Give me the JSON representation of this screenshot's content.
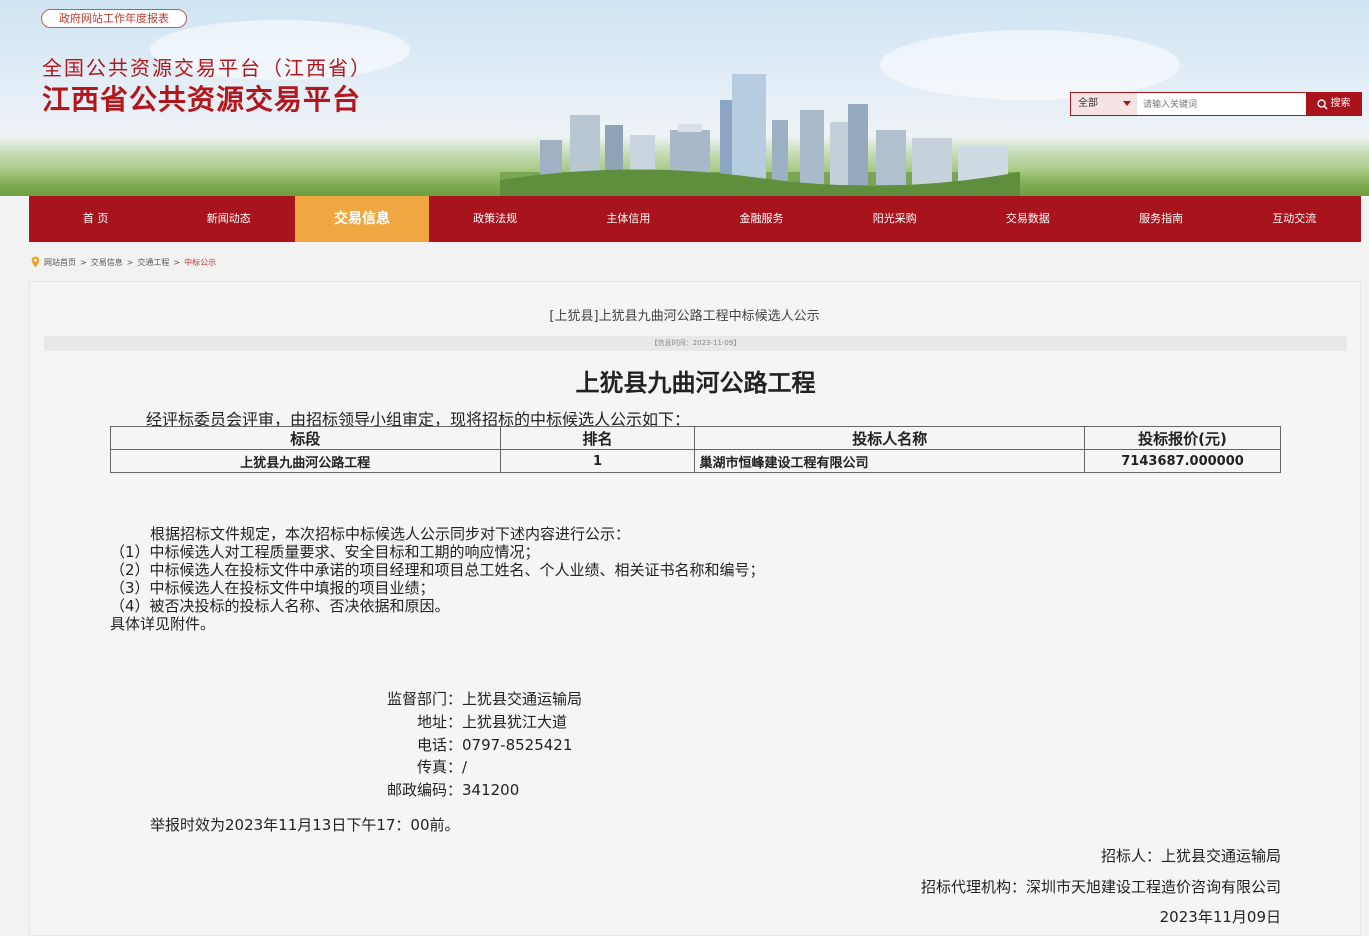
{
  "header": {
    "report_link": "政府网站工作年度报表",
    "title_line1": "全国公共资源交易平台（江西省）",
    "title_line2": "江西省公共资源交易平台",
    "search": {
      "scope": "全部",
      "placeholder": "请输入关键词",
      "button": "搜索"
    }
  },
  "nav": {
    "items": [
      "首 页",
      "新闻动态",
      "交易信息",
      "政策法规",
      "主体信用",
      "金融服务",
      "阳光采购",
      "交易数据",
      "服务指南",
      "互动交流"
    ],
    "active": "交易信息"
  },
  "breadcrumb": {
    "items": [
      "网站首页",
      "交易信息",
      "交通工程"
    ],
    "current": "中标公示"
  },
  "article": {
    "title": "[上犹县]上犹县九曲河公路工程中标候选人公示",
    "info_time": "【信息时间：2023-11-09】",
    "heading": "上犹县九曲河公路工程",
    "intro": "经评标委员会评审，由招标领导小组审定，现将招标的中标候选人公示如下：",
    "table": {
      "headers": [
        "标段",
        "排名",
        "投标人名称",
        "投标报价(元)"
      ],
      "rows": [
        [
          "上犹县九曲河公路工程",
          "1",
          "巢湖市恒峰建设工程有限公司",
          "7143687.000000"
        ]
      ]
    },
    "body": [
      "根据招标文件规定，本次招标中标候选人公示同步对下述内容进行公示：",
      "（1）中标候选人对工程质量要求、安全目标和工期的响应情况；",
      "（2）中标候选人在投标文件中承诺的项目经理和项目总工姓名、个人业绩、相关证书名称和编号；",
      "（3）中标候选人在投标文件中填报的项目业绩；",
      "（4）被否决投标的投标人名称、否决依据和原因。",
      "具体详见附件。"
    ],
    "contacts": [
      {
        "label": "监督部门：",
        "value": "上犹县交通运输局"
      },
      {
        "label": "地址：",
        "value": "上犹县犹江大道"
      },
      {
        "label": "电话：",
        "value": "0797-8525421"
      },
      {
        "label": "传真：",
        "value": "/"
      },
      {
        "label": "邮政编码：",
        "value": "341200"
      }
    ],
    "deadline": "举报时效为2023年11月13日下午17：00前。",
    "tenderer": "招标人：上犹县交通运输局",
    "agency": "招标代理机构：深圳市天旭建设工程造价咨询有限公司",
    "date": "2023年11月09日"
  }
}
